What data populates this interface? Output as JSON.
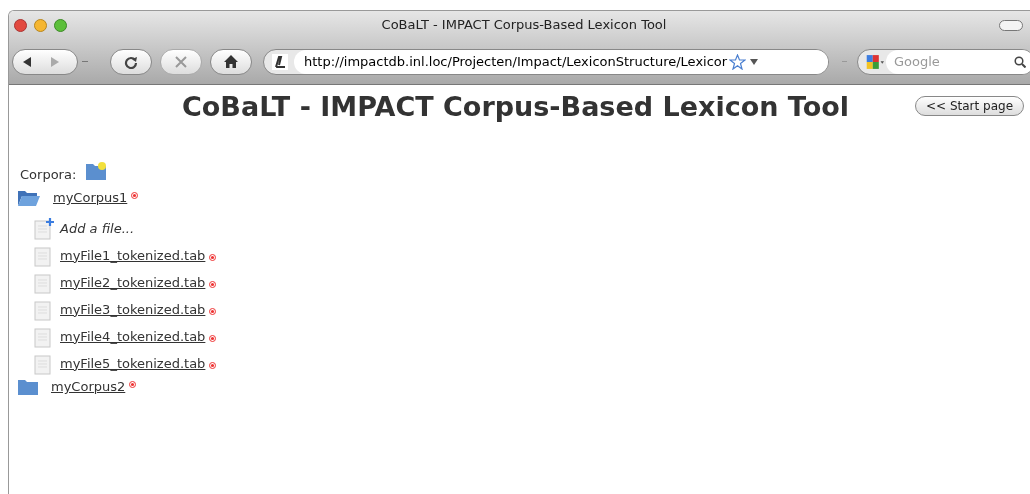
{
  "window": {
    "title": "CoBaLT - IMPACT Corpus-Based Lexicon Tool"
  },
  "toolbar": {
    "address": "http://impactdb.inl.loc/Projecten/Impact/LexiconStructure/Lexicor",
    "search": {
      "placeholder": "Google"
    }
  },
  "page": {
    "heading": "CoBaLT - IMPACT Corpus-Based Lexicon Tool",
    "start_button": "<< Start page",
    "corpora_label": "Corpora:",
    "corpora": [
      {
        "name": "myCorpus1",
        "expanded": true,
        "add_file": "Add a file...",
        "files": [
          {
            "name": "myFile1_tokenized.tab"
          },
          {
            "name": "myFile2_tokenized.tab"
          },
          {
            "name": "myFile3_tokenized.tab"
          },
          {
            "name": "myFile4_tokenized.tab"
          },
          {
            "name": "myFile5_tokenized.tab"
          }
        ]
      },
      {
        "name": "myCorpus2",
        "expanded": false
      }
    ]
  }
}
